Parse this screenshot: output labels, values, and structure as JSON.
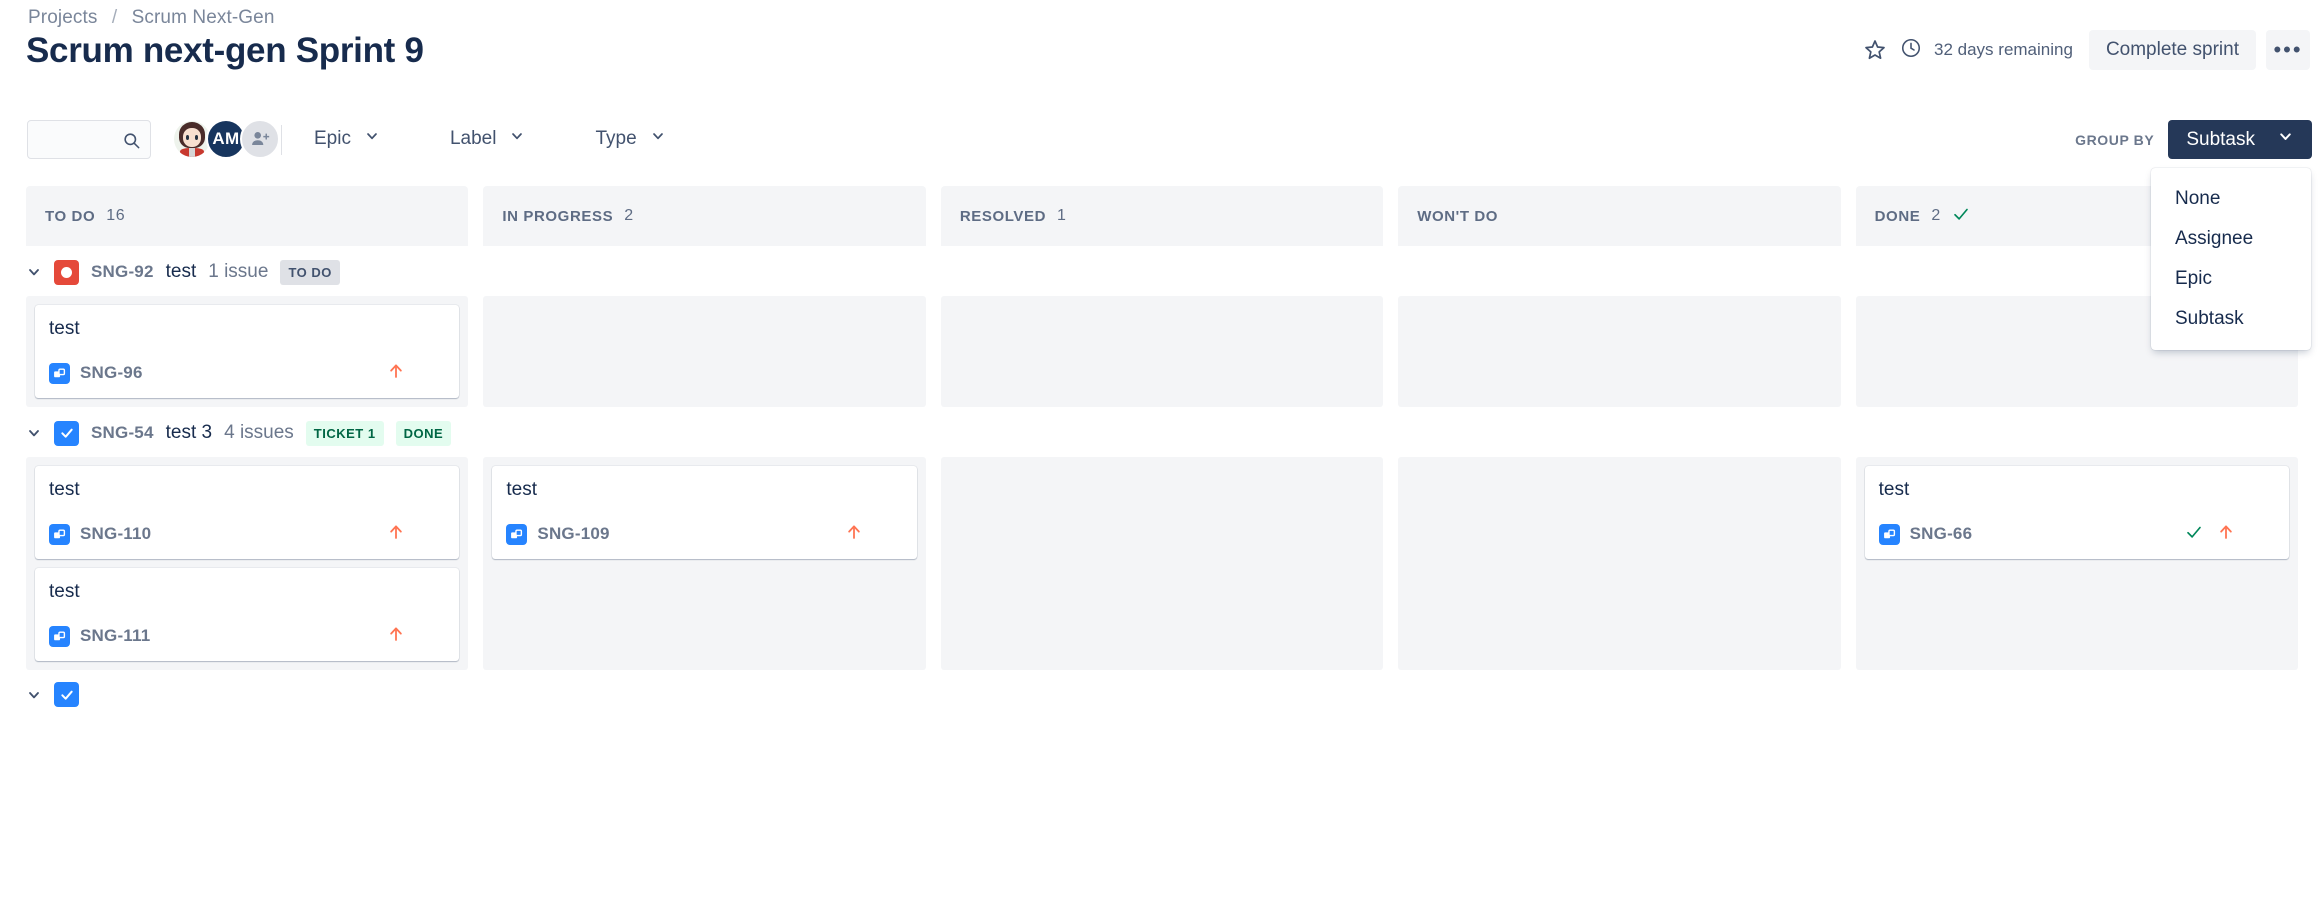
{
  "breadcrumb": {
    "projects": "Projects",
    "separator": "/",
    "project": "Scrum Next-Gen"
  },
  "header": {
    "title": "Scrum next-gen Sprint 9",
    "star_icon": "star-icon",
    "clock_icon": "clock-icon",
    "days_remaining": "32 days remaining",
    "complete_sprint": "Complete sprint",
    "more_actions": "•••"
  },
  "toolbar": {
    "search": {
      "value": "",
      "placeholder": ""
    },
    "avatars": [
      {
        "name": "user-avatar-photo",
        "type": "photo"
      },
      {
        "name": "user-avatar-initials",
        "type": "initials",
        "initials": "AM",
        "color": "#17355e"
      },
      {
        "name": "add-people-button",
        "type": "add"
      }
    ],
    "filters": [
      {
        "label": "Epic",
        "name": "epic-filter"
      },
      {
        "label": "Label",
        "name": "label-filter"
      },
      {
        "label": "Type",
        "name": "type-filter"
      }
    ],
    "group_by": {
      "label": "GROUP BY",
      "selected": "Subtask",
      "options": [
        "None",
        "Assignee",
        "Epic",
        "Subtask"
      ],
      "open": true
    }
  },
  "board": {
    "columns": [
      {
        "name": "TO DO",
        "count": "16",
        "done": false
      },
      {
        "name": "IN PROGRESS",
        "count": "2",
        "done": false
      },
      {
        "name": "RESOLVED",
        "count": "1",
        "done": false
      },
      {
        "name": "WON'T DO",
        "count": "",
        "done": false
      },
      {
        "name": "DONE",
        "count": "2",
        "done": true
      }
    ],
    "swimlanes": [
      {
        "key": "SNG-92",
        "title": "test",
        "issues": "1 issue",
        "icon": "story-icon",
        "icon_type": "story",
        "badges": [
          {
            "text": "TO DO",
            "style": "todo"
          }
        ],
        "cards": [
          [
            {
              "title": "test",
              "key": "SNG-96",
              "priority": "high-priority-arrow-icon",
              "done": false
            }
          ],
          [],
          [],
          [],
          []
        ]
      },
      {
        "key": "SNG-54",
        "title": "test 3",
        "issues": "4 issues",
        "icon": "task-icon",
        "icon_type": "task",
        "badges": [
          {
            "text": "TICKET 1",
            "style": "done"
          },
          {
            "text": "DONE",
            "style": "done"
          }
        ],
        "cards": [
          [
            {
              "title": "test",
              "key": "SNG-110",
              "priority": "high-priority-arrow-icon",
              "done": false
            },
            {
              "title": "test",
              "key": "SNG-111",
              "priority": "high-priority-arrow-icon",
              "done": false
            }
          ],
          [
            {
              "title": "test",
              "key": "SNG-109",
              "priority": "high-priority-arrow-icon",
              "done": false
            }
          ],
          [],
          [],
          [
            {
              "title": "test",
              "key": "SNG-66",
              "priority": "high-priority-arrow-icon",
              "done": true
            }
          ]
        ]
      }
    ]
  },
  "colors": {
    "accent": "#2684ff",
    "brand_dark": "#253858",
    "story": "#e5493a",
    "done_green": "#00875a",
    "priority_orange": "#ff7452",
    "panel": "#f4f5f7"
  }
}
